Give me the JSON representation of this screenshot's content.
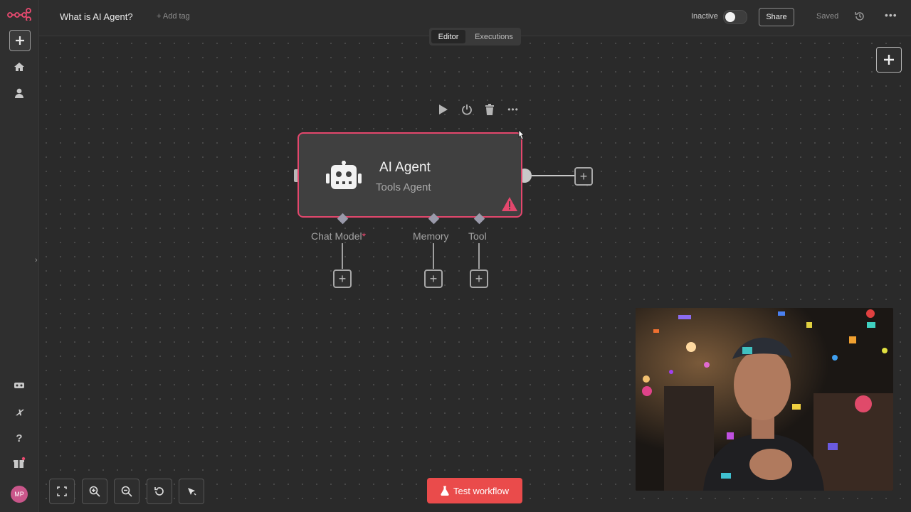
{
  "header": {
    "workflow_title": "What is AI Agent?",
    "add_tag": "+ Add tag",
    "status_label": "Inactive",
    "active": false,
    "share_label": "Share",
    "saved_label": "Saved"
  },
  "tabs": {
    "editor": "Editor",
    "executions": "Executions",
    "selected": "Editor"
  },
  "sidebar": {
    "icons": [
      "n8n-logo-icon",
      "add-icon",
      "home-icon",
      "user-icon",
      "templates-icon",
      "variables-icon",
      "help-icon",
      "gift-icon"
    ],
    "avatar_initials": "MP"
  },
  "node": {
    "title": "AI Agent",
    "subtitle": "Tools Agent",
    "icon": "robot-icon",
    "has_warning": true,
    "accent": "#e4476d",
    "sub_nodes": [
      {
        "label": "Chat Model",
        "required_mark": "*"
      },
      {
        "label": "Memory",
        "required_mark": ""
      },
      {
        "label": "Tool",
        "required_mark": ""
      }
    ]
  },
  "node_toolbar": [
    "play-icon",
    "power-icon",
    "trash-icon",
    "more-icon"
  ],
  "canvas_controls": [
    "fit-view-icon",
    "zoom-in-icon",
    "zoom-out-icon",
    "reset-zoom-icon",
    "tidy-up-icon"
  ],
  "test_button": {
    "label": "Test workflow",
    "icon": "flask-icon",
    "color": "#ea4b4b"
  },
  "colors": {
    "canvas_bg": "#2a2a2a",
    "node_bg": "#404040",
    "accent": "#e4476d",
    "brand": "#ea4b71"
  }
}
